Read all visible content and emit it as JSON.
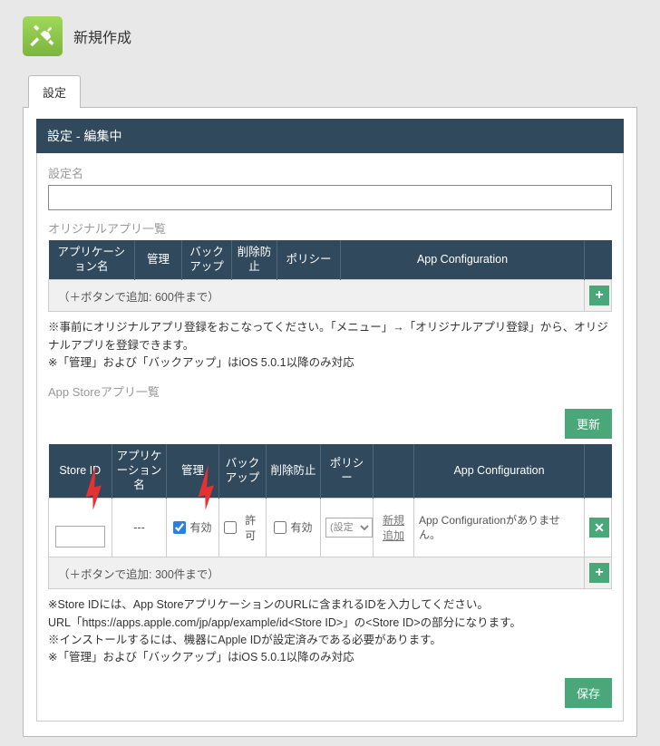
{
  "page_title": "新規作成",
  "tab_label": "設定",
  "section_header": "設定 - 編集中",
  "setting_name": {
    "label": "設定名",
    "value": ""
  },
  "original": {
    "title": "オリジナルアプリ一覧",
    "headers": [
      "アプリケーション名",
      "管理",
      "バックアップ",
      "削除防止",
      "ポリシー",
      "App Configuration"
    ],
    "add_line": "（＋ボタンで追加: 600件まで）",
    "notes": "※事前にオリジナルアプリ登録をおこなってください。「メニュー」→「オリジナルアプリ登録」から、オリジナルアプリを登録できます。\n※「管理」および「バックアップ」はiOS 5.0.1以降のみ対応"
  },
  "appstore": {
    "title": "App Storeアプリ一覧",
    "update_button": "更新",
    "headers": [
      "Store ID",
      "アプリケーション名",
      "管理",
      "バックアップ",
      "削除防止",
      "ポリシー",
      "",
      "App Configuration"
    ],
    "row": {
      "store_id": "",
      "app_name": "---",
      "manage": {
        "checked": true,
        "label": "有効"
      },
      "backup": {
        "checked": false,
        "label": "許可"
      },
      "delete_protect": {
        "checked": false,
        "label": "有効"
      },
      "policy_placeholder": "(設定",
      "new_add_link": "新規追加",
      "appconfig_text": "App Configurationがありません。"
    },
    "add_line": "（＋ボタンで追加: 300件まで）",
    "notes": "※Store IDには、App Storeアプリケーションの​URLに含まれるIDを入力してください。\nURL「https://apps.apple.com/jp/app/example/id<Store ID>」の<Store ID>の部分になります。\n※インストールするには、機器にApple IDが設定済みである必要があります。\n※「管理」および「バックアップ」はiOS 5.0.1以降のみ対応"
  },
  "save_button": "保存"
}
